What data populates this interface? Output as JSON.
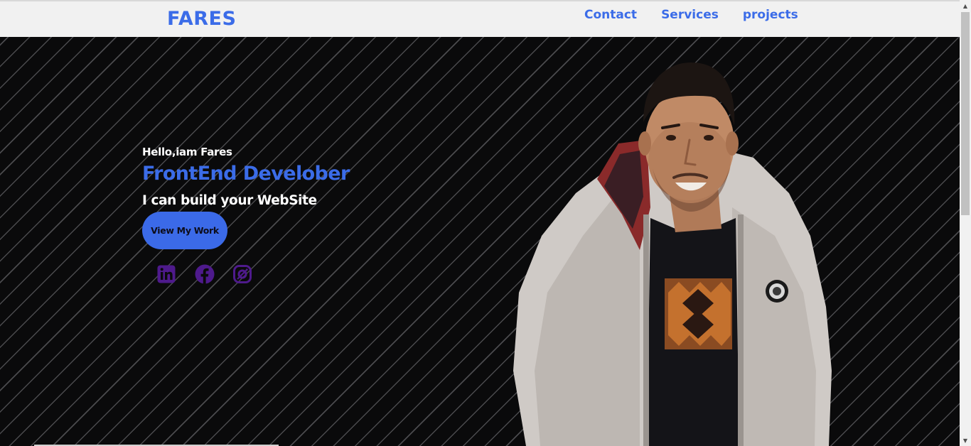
{
  "header": {
    "logo": "FARES",
    "nav": [
      {
        "label": "Contact"
      },
      {
        "label": "Services"
      },
      {
        "label": "projects"
      }
    ]
  },
  "hero": {
    "greeting": "Hello,iam Fares",
    "role": "FrontEnd Develober",
    "tagline": "I can build your WebSite",
    "cta_label": "View My Work",
    "socials": [
      {
        "icon": "linkedin-icon"
      },
      {
        "icon": "facebook-icon"
      },
      {
        "icon": "instagram-icon"
      }
    ],
    "photo": "portrait of a smiling man in a light puffer jacket"
  },
  "colors": {
    "brand_blue": "#3b6ce8",
    "social_purple": "#4e1a8c",
    "hero_background": "#0a0a0b",
    "header_background": "#f1f1f1"
  }
}
